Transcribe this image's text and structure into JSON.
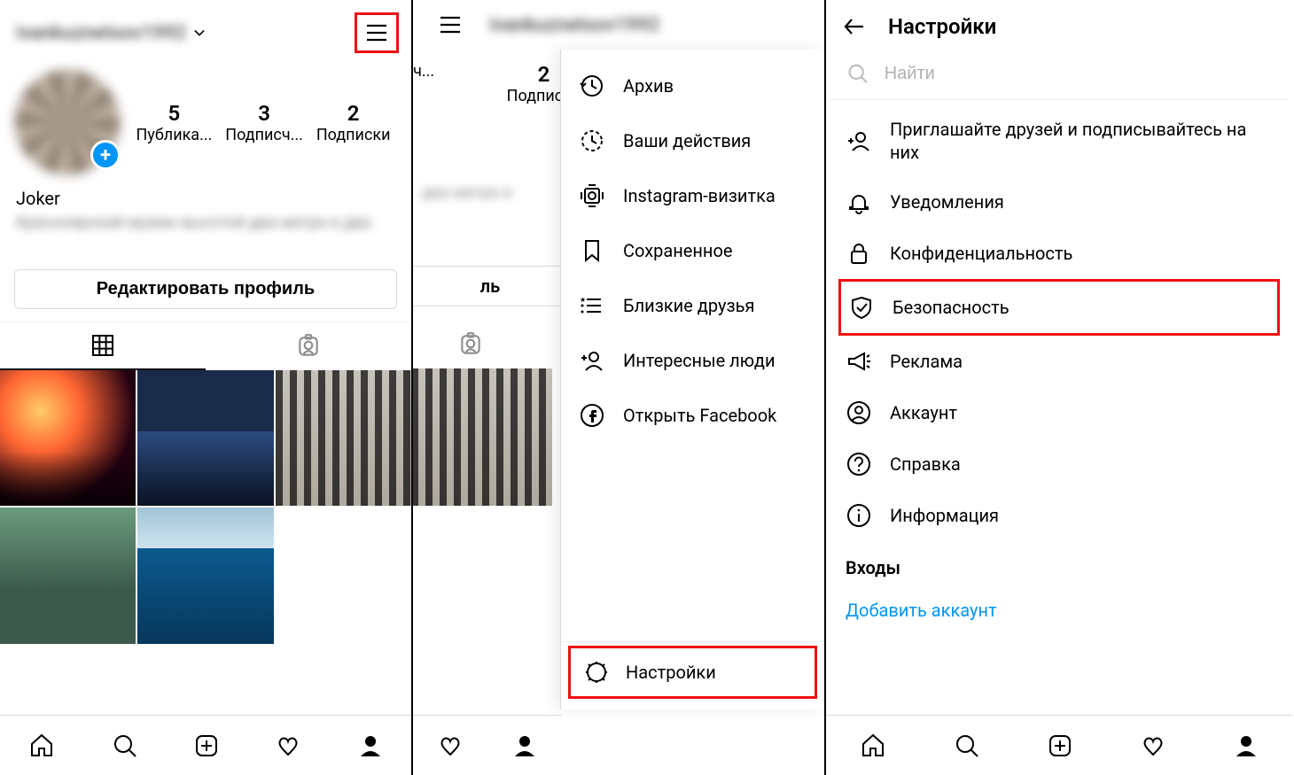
{
  "pane1": {
    "username": "ivankuznetsov1992",
    "chevron": "⌄",
    "stats": [
      {
        "num": "5",
        "label": "Публика..."
      },
      {
        "num": "3",
        "label": "Подписч..."
      },
      {
        "num": "2",
        "label": "Подписки"
      }
    ],
    "bio_name": "Joker",
    "bio_desc": "Красноярский мужик высотой два метра и два",
    "edit_button": "Редактировать профиль"
  },
  "pane2": {
    "username": "ivankuznetsov1992",
    "bg_stats": [
      {
        "num": "",
        "label": "сч..."
      },
      {
        "num": "2",
        "label": "Подписки"
      }
    ],
    "bg_bio": "два метра и",
    "bg_edit": "ль",
    "menu": [
      {
        "icon": "archive",
        "label": "Архив"
      },
      {
        "icon": "activity",
        "label": "Ваши действия"
      },
      {
        "icon": "card",
        "label": "Instagram-визитка"
      },
      {
        "icon": "bookmark",
        "label": "Сохраненное"
      },
      {
        "icon": "close-friends",
        "label": "Близкие друзья"
      },
      {
        "icon": "discover",
        "label": "Интересные люди"
      },
      {
        "icon": "facebook",
        "label": "Открыть Facebook"
      }
    ],
    "settings_label": "Настройки"
  },
  "pane3": {
    "title": "Настройки",
    "search_placeholder": "Найти",
    "items": [
      {
        "icon": "invite",
        "label": "Приглашайте друзей и подписывайтесь на них"
      },
      {
        "icon": "bell",
        "label": "Уведомления"
      },
      {
        "icon": "lock",
        "label": "Конфиденциальность"
      },
      {
        "icon": "shield",
        "label": "Безопасность"
      },
      {
        "icon": "ads",
        "label": "Реклама"
      },
      {
        "icon": "account",
        "label": "Аккаунт"
      },
      {
        "icon": "help",
        "label": "Справка"
      },
      {
        "icon": "info",
        "label": "Информация"
      }
    ],
    "section_title": "Входы",
    "add_account": "Добавить аккаунт"
  }
}
